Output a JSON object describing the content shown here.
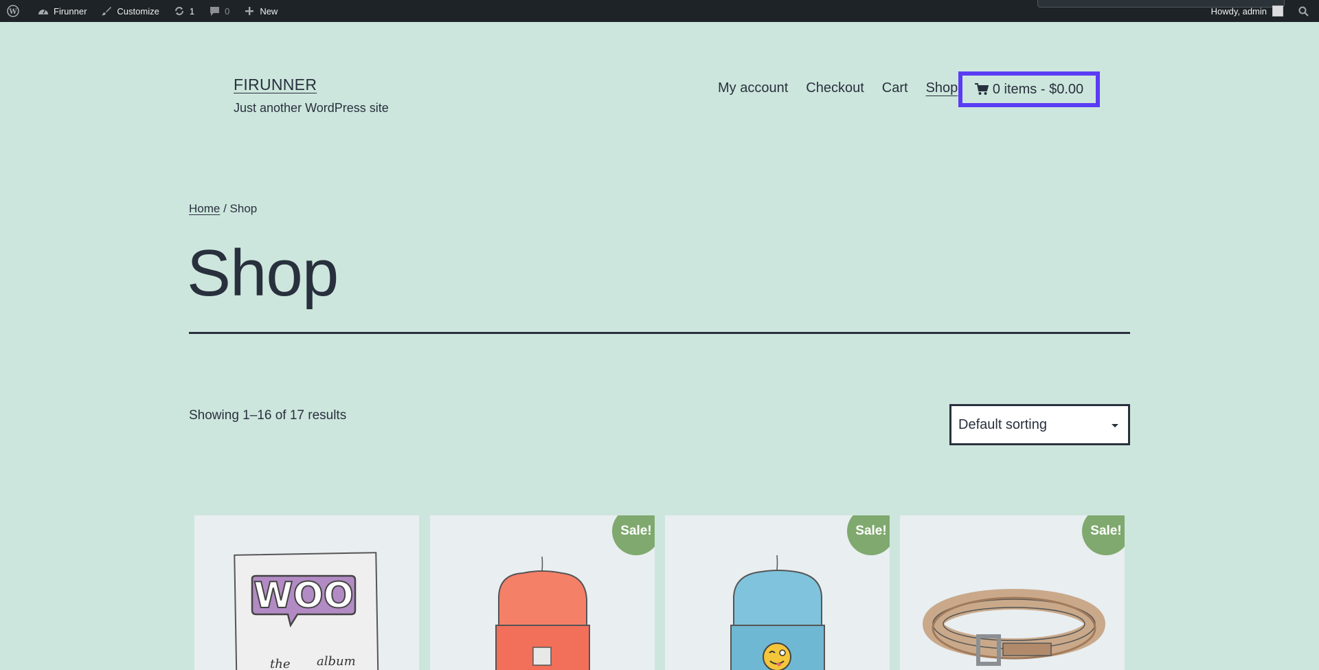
{
  "adminbar": {
    "site_name": "Firunner",
    "customize": "Customize",
    "updates_count": "1",
    "comments_count": "0",
    "new_label": "New",
    "howdy": "Howdy, admin"
  },
  "header": {
    "site_title": "FIRUNNER",
    "tagline": "Just another WordPress site",
    "nav": [
      "My account",
      "Checkout",
      "Cart",
      "Shop"
    ],
    "cart_summary": "0 items - $0.00"
  },
  "breadcrumb": {
    "home": "Home",
    "separator": " / ",
    "current": "Shop"
  },
  "page": {
    "title": "Shop",
    "result_count": "Showing 1–16 of 17 results",
    "sorting_selected": "Default sorting"
  },
  "products": [
    {
      "image": "woo-album",
      "sale": false
    },
    {
      "image": "red-beanie",
      "sale": true,
      "badge": "Sale!"
    },
    {
      "image": "blue-beanie-emoji",
      "sale": true,
      "badge": "Sale!"
    },
    {
      "image": "leather-belt",
      "sale": true,
      "badge": "Sale!"
    }
  ],
  "colors": {
    "background": "#cde6dd",
    "adminbar": "#1d2327",
    "text": "#28303d",
    "cart_highlight": "#5b3cf5",
    "sale_badge": "#7fa96e"
  }
}
